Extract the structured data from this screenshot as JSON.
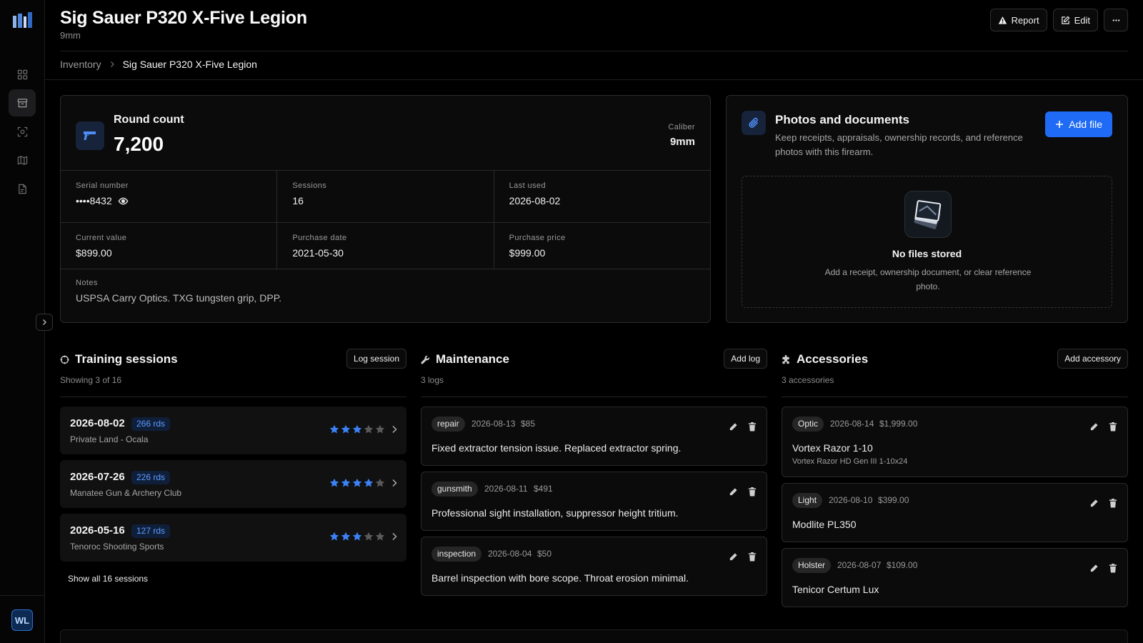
{
  "header": {
    "title": "Sig Sauer P320 X-Five Legion",
    "subtitle": "9mm",
    "report_label": "Report",
    "edit_label": "Edit"
  },
  "breadcrumb": {
    "root": "Inventory",
    "current": "Sig Sauer P320 X-Five Legion"
  },
  "sidebar": {
    "items": [
      "dashboard-icon",
      "inventory-icon",
      "target-icon",
      "map-icon",
      "document-icon"
    ],
    "avatar_initials": "WL"
  },
  "details": {
    "round_label": "Round count",
    "round_value": "7,200",
    "caliber_label": "Caliber",
    "caliber_value": "9mm",
    "serial_label": "Serial number",
    "serial_value": "••••8432",
    "sessions_label": "Sessions",
    "sessions_value": "16",
    "last_used_label": "Last used",
    "last_used_value": "2026-08-02",
    "current_value_label": "Current value",
    "current_value": "$899.00",
    "purchase_date_label": "Purchase date",
    "purchase_date_value": "2021-05-30",
    "purchase_price_label": "Purchase price",
    "purchase_price_value": "$999.00",
    "notes_label": "Notes",
    "notes_value": "USPSA Carry Optics. TXG tungsten grip, DPP."
  },
  "photos": {
    "title": "Photos and documents",
    "description": "Keep receipts, appraisals, ownership records, and reference photos with this firearm.",
    "add_label": "Add file",
    "empty_title": "No files stored",
    "empty_desc": "Add a receipt, ownership document, or clear reference photo."
  },
  "training": {
    "title": "Training sessions",
    "button": "Log session",
    "subtitle": "Showing 3 of 16",
    "show_all": "Show all 16 sessions",
    "items": [
      {
        "date": "2026-08-02",
        "rounds": "266 rds",
        "location": "Private Land - Ocala",
        "rating": 3
      },
      {
        "date": "2026-07-26",
        "rounds": "226 rds",
        "location": "Manatee Gun & Archery Club",
        "rating": 4
      },
      {
        "date": "2026-05-16",
        "rounds": "127 rds",
        "location": "Tenoroc Shooting Sports",
        "rating": 3
      }
    ]
  },
  "maintenance": {
    "title": "Maintenance",
    "button": "Add log",
    "subtitle": "3 logs",
    "items": [
      {
        "tag": "repair",
        "date": "2026-08-13",
        "cost": "$85",
        "text": "Fixed extractor tension issue. Replaced extractor spring."
      },
      {
        "tag": "gunsmith",
        "date": "2026-08-11",
        "cost": "$491",
        "text": "Professional sight installation, suppressor height tritium."
      },
      {
        "tag": "inspection",
        "date": "2026-08-04",
        "cost": "$50",
        "text": "Barrel inspection with bore scope. Throat erosion minimal."
      }
    ]
  },
  "accessories": {
    "title": "Accessories",
    "button": "Add accessory",
    "subtitle": "3 accessories",
    "items": [
      {
        "tag": "Optic",
        "date": "2026-08-14",
        "cost": "$1,999.00",
        "name": "Vortex Razor 1-10",
        "detail": "Vortex Razor HD Gen III 1-10x24"
      },
      {
        "tag": "Light",
        "date": "2026-08-10",
        "cost": "$399.00",
        "name": "Modlite PL350",
        "detail": ""
      },
      {
        "tag": "Holster",
        "date": "2026-08-07",
        "cost": "$109.00",
        "name": "Tenicor Certum Lux",
        "detail": ""
      }
    ]
  },
  "colors": {
    "accent": "#1f6bf5",
    "star_on": "#3b82f6",
    "star_off": "#5a5a5a"
  }
}
